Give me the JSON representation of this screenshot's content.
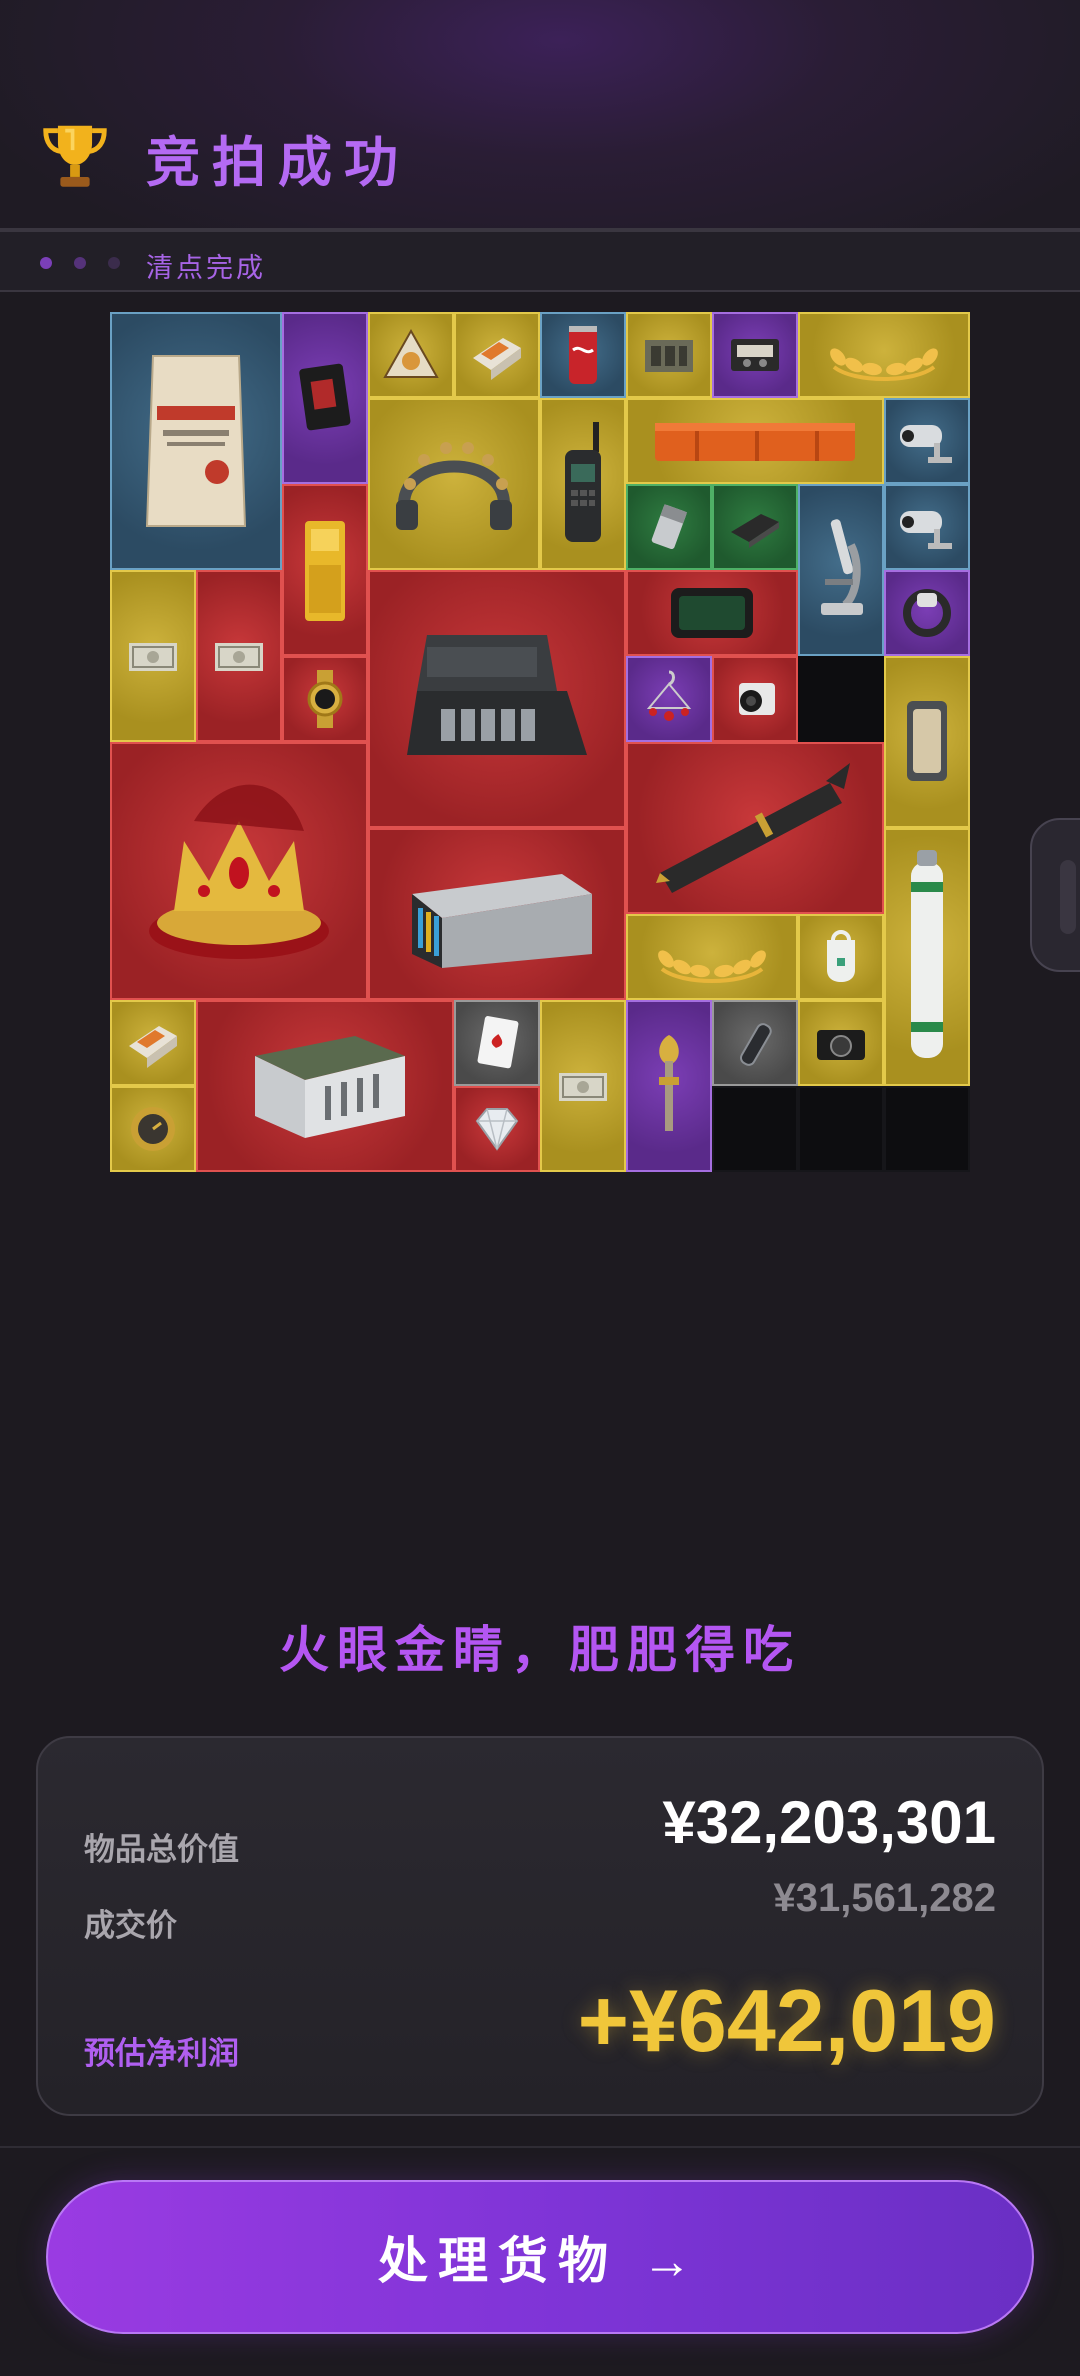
{
  "header": {
    "title": "竞拍成功",
    "icon": "trophy-icon"
  },
  "status_bar": {
    "text": "清点完成",
    "dots": 3
  },
  "inventory_grid": {
    "columns": 10,
    "rows": 10,
    "items": [
      {
        "name": "cement-bag",
        "rarity": "blue"
      },
      {
        "name": "pouch",
        "rarity": "purple"
      },
      {
        "name": "nachos",
        "rarity": "gold"
      },
      {
        "name": "explosive-brick",
        "rarity": "gold"
      },
      {
        "name": "soda-can",
        "rarity": "blue"
      },
      {
        "name": "circuit-board",
        "rarity": "gold"
      },
      {
        "name": "cassette-tape",
        "rarity": "purple"
      },
      {
        "name": "laurel-wreath",
        "rarity": "gold"
      },
      {
        "name": "neural-headset",
        "rarity": "gold"
      },
      {
        "name": "radio-transceiver",
        "rarity": "gold"
      },
      {
        "name": "orange-case",
        "rarity": "gold"
      },
      {
        "name": "security-camera",
        "rarity": "blue"
      },
      {
        "name": "gold-bar",
        "rarity": "red"
      },
      {
        "name": "lighter",
        "rarity": "green"
      },
      {
        "name": "hard-drive",
        "rarity": "green"
      },
      {
        "name": "microscope",
        "rarity": "blue"
      },
      {
        "name": "security-camera",
        "rarity": "blue"
      },
      {
        "name": "banknotes",
        "rarity": "gold"
      },
      {
        "name": "banknotes",
        "rarity": "red"
      },
      {
        "name": "processor-case",
        "rarity": "red"
      },
      {
        "name": "tablet",
        "rarity": "red"
      },
      {
        "name": "smart-band",
        "rarity": "purple"
      },
      {
        "name": "gold-watch",
        "rarity": "red"
      },
      {
        "name": "earring",
        "rarity": "purple"
      },
      {
        "name": "camera-module",
        "rarity": "red"
      },
      {
        "name": "artifact-frame",
        "rarity": "gold"
      },
      {
        "name": "royal-crown",
        "rarity": "red"
      },
      {
        "name": "missile",
        "rarity": "red"
      },
      {
        "name": "server-nas",
        "rarity": "red"
      },
      {
        "name": "oxygen-tank",
        "rarity": "gold"
      },
      {
        "name": "laurel-wreath",
        "rarity": "gold"
      },
      {
        "name": "tag-device",
        "rarity": "gold"
      },
      {
        "name": "explosive-brick",
        "rarity": "gold"
      },
      {
        "name": "military-crate",
        "rarity": "red"
      },
      {
        "name": "playing-card",
        "rarity": "grey"
      },
      {
        "name": "banknotes",
        "rarity": "gold"
      },
      {
        "name": "ornate-key",
        "rarity": "purple"
      },
      {
        "name": "glass-vial",
        "rarity": "grey"
      },
      {
        "name": "digital-camera",
        "rarity": "gold"
      },
      {
        "name": "pocket-watch",
        "rarity": "gold"
      },
      {
        "name": "diamond",
        "rarity": "red"
      }
    ]
  },
  "slogan": "火眼金睛，肥肥得吃",
  "summary": {
    "total_label": "物品总价值",
    "total_value": "¥32,203,301",
    "deal_label": "成交价",
    "deal_value": "¥31,561,282",
    "profit_label": "预估净利润",
    "profit_value": "+¥642,019"
  },
  "action_button": {
    "label": "处理货物 →"
  },
  "colors": {
    "accent_purple": "#b46af3",
    "profit_gold": "#f0c63a",
    "background": "#1d1a20",
    "rarity_gold": "#c5a82d",
    "rarity_red": "#b52d30",
    "rarity_blue": "#3a607c",
    "rarity_purple": "#6c34a0",
    "rarity_green": "#286b38",
    "rarity_grey": "#5a5a5a"
  }
}
